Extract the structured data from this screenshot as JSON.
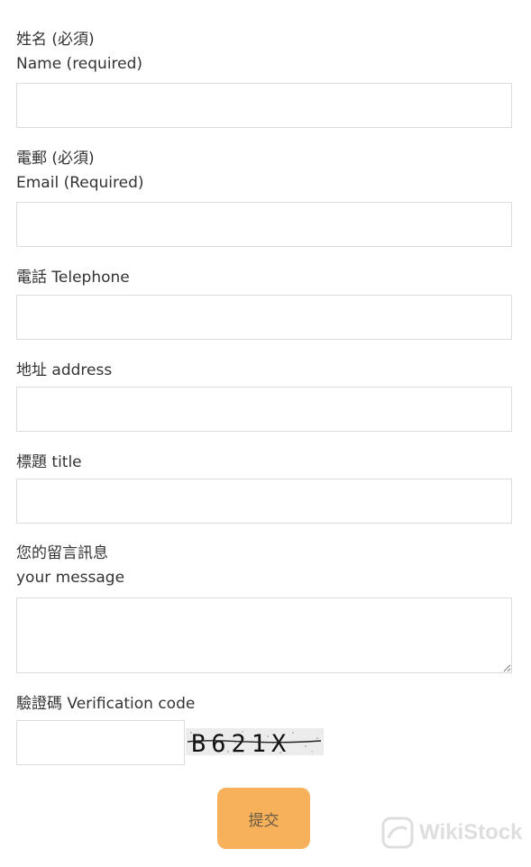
{
  "fields": [
    {
      "label_line1": "姓名 (必須)",
      "label_line2": "Name (required)",
      "value": "",
      "placeholder": ""
    },
    {
      "label_line1": "電郵 (必須)",
      "label_line2": "Email (Required)",
      "value": "",
      "placeholder": ""
    },
    {
      "label_line1": "電話 Telephone",
      "value": "",
      "placeholder": ""
    },
    {
      "label_line1": "地址 address",
      "value": "",
      "placeholder": ""
    },
    {
      "label_line1": "標題 title",
      "value": "",
      "placeholder": ""
    },
    {
      "label_line1": "您的留言訊息",
      "label_line2": "your message",
      "value": "",
      "placeholder": ""
    }
  ],
  "captcha": {
    "label": "驗證碼 Verification code",
    "value": "",
    "image_text": "B621X"
  },
  "submit_label": "提交",
  "colors": {
    "submit_bg": "#f7b15a",
    "border": "#dcdcdc",
    "text": "#333333"
  },
  "watermark": {
    "text": "WikiStock",
    "icon": "wikistock-logo-icon"
  }
}
